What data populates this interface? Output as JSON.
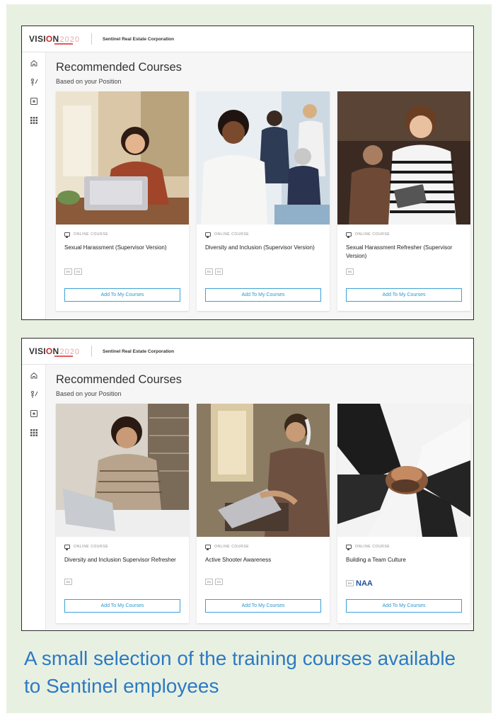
{
  "screens": [
    {
      "logo": {
        "text": "VISI",
        "o": "O",
        "n": "N",
        "year": "2020"
      },
      "org_name": "Sentinel Real Estate Corporation",
      "heading": "Recommended Courses",
      "subheading": "Based on your Position",
      "nav_icons": [
        "home-icon",
        "career-icon",
        "badge-icon",
        "apps-grid-icon"
      ],
      "courses": [
        {
          "type": "ONLINE COURSE",
          "title": "Sexual Harassment (Supervisor Version)",
          "languages": [
            "EN",
            "ES"
          ],
          "button": "Add To My Courses",
          "image": "woman-laptop-cafe"
        },
        {
          "type": "ONLINE COURSE",
          "title": "Diversity and Inclusion (Supervisor Version)",
          "languages": [
            "EN",
            "ES"
          ],
          "button": "Add To My Courses",
          "image": "diverse-office-team"
        },
        {
          "type": "ONLINE COURSE",
          "title": "Sexual Harassment Refresher (Supervisor Version)",
          "languages": [
            "EN"
          ],
          "button": "Add To My Courses",
          "image": "woman-tablet-office"
        }
      ]
    },
    {
      "logo": {
        "text": "VISI",
        "o": "O",
        "n": "N",
        "year": "2020"
      },
      "org_name": "Sentinel Real Estate Corporation",
      "heading": "Recommended Courses",
      "subheading": "Based on your Position",
      "nav_icons": [
        "home-icon",
        "career-icon",
        "badge-icon",
        "apps-grid-icon"
      ],
      "courses": [
        {
          "type": "ONLINE COURSE",
          "title": "Diversity and Inclusion Supervisor Refresher",
          "languages": [
            "EN"
          ],
          "button": "Add To My Courses",
          "image": "woman-laptop-desk"
        },
        {
          "type": "ONLINE COURSE",
          "title": "Active Shooter Awareness",
          "languages": [
            "EN",
            "ES"
          ],
          "button": "Add To My Courses",
          "image": "man-headphones-laptop"
        },
        {
          "type": "ONLINE COURSE",
          "title": "Building a Team Culture",
          "languages": [
            "EN"
          ],
          "partner_logo": "NAA",
          "button": "Add To My Courses",
          "image": "team-hands-stacked"
        }
      ]
    }
  ],
  "caption": "A small selection of the training courses available to Sentinel employees",
  "colors": {
    "accent": "#2b97d2",
    "caption": "#2d79c4",
    "background": "#e8f1e1",
    "logo_red": "#cc2a2a"
  }
}
